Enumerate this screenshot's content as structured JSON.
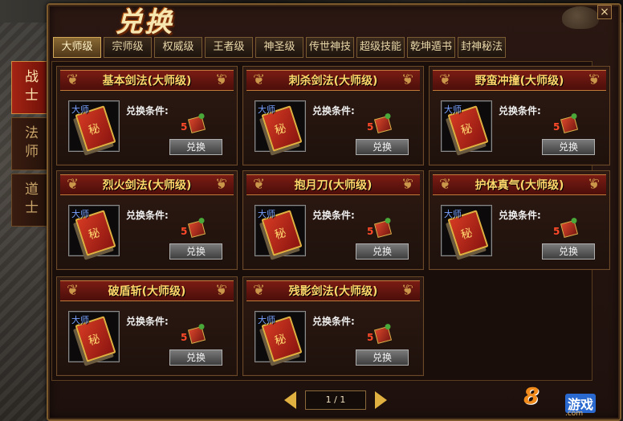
{
  "window": {
    "title": "兑换",
    "close_label": "×"
  },
  "class_tabs": [
    {
      "label": "战士",
      "active": true
    },
    {
      "label": "法师",
      "active": false
    },
    {
      "label": "道士",
      "active": false
    }
  ],
  "tabs": [
    {
      "label": "大师级",
      "active": true
    },
    {
      "label": "宗师级",
      "active": false
    },
    {
      "label": "权威级",
      "active": false
    },
    {
      "label": "王者级",
      "active": false
    },
    {
      "label": "神圣级",
      "active": false
    },
    {
      "label": "传世神技",
      "active": false
    },
    {
      "label": "超级技能",
      "active": false
    },
    {
      "label": "乾坤遁书",
      "active": false
    },
    {
      "label": "封神秘法",
      "active": false
    }
  ],
  "cards": [
    {
      "title": "基本剑法(大师级)",
      "slot_label": "大师",
      "cond_label": "兑换条件:",
      "cost": "5",
      "button": "兑换"
    },
    {
      "title": "刺杀剑法(大师级)",
      "slot_label": "大师",
      "cond_label": "兑换条件:",
      "cost": "5",
      "button": "兑换"
    },
    {
      "title": "野蛮冲撞(大师级)",
      "slot_label": "大师",
      "cond_label": "兑换条件:",
      "cost": "5",
      "button": "兑换"
    },
    {
      "title": "烈火剑法(大师级)",
      "slot_label": "大师",
      "cond_label": "兑换条件:",
      "cost": "5",
      "button": "兑换"
    },
    {
      "title": "抱月刀(大师级)",
      "slot_label": "大师",
      "cond_label": "兑换条件:",
      "cost": "5",
      "button": "兑换"
    },
    {
      "title": "护体真气(大师级)",
      "slot_label": "大师",
      "cond_label": "兑换条件:",
      "cost": "5",
      "button": "兑换"
    },
    {
      "title": "破盾斩(大师级)",
      "slot_label": "大师",
      "cond_label": "兑换条件:",
      "cost": "5",
      "button": "兑换"
    },
    {
      "title": "残影剑法(大师级)",
      "slot_label": "大师",
      "cond_label": "兑换条件:",
      "cost": "5",
      "button": "兑换"
    }
  ],
  "pager": {
    "text": "1 / 1"
  },
  "watermark": {
    "num": "8",
    "text": "游戏",
    "sub": ".com"
  },
  "colors": {
    "accent_gold": "#ffd66a",
    "cost_red": "#ff4a2a",
    "active_tab": "#8a6a34",
    "active_class": "#a42414"
  }
}
